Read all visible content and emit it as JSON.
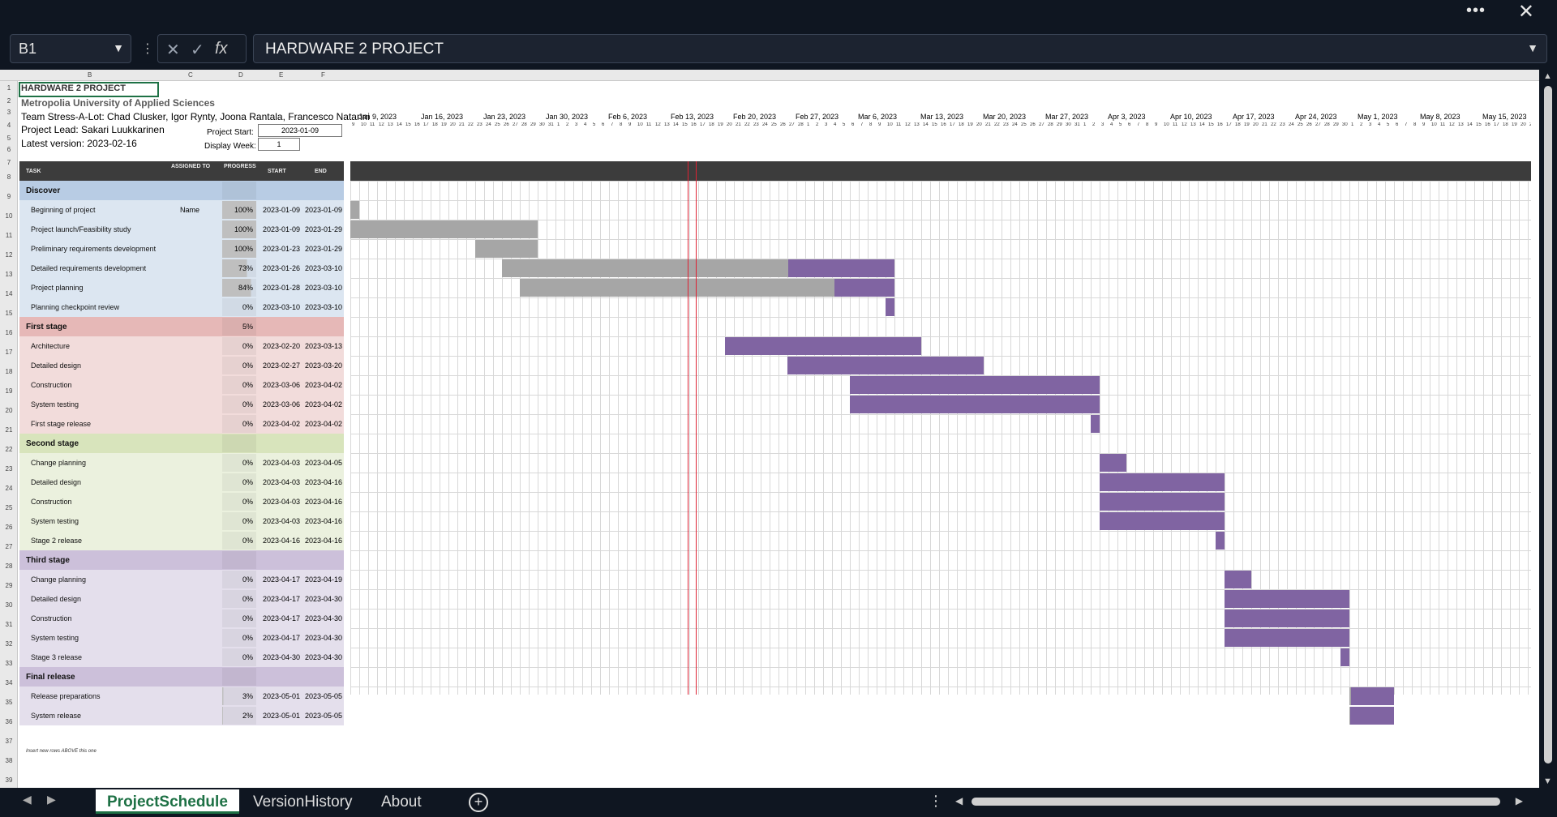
{
  "window": {
    "more_icon": "ellipsis-icon",
    "close_icon": "close-icon"
  },
  "formula_bar": {
    "name_box": "B1",
    "formula": "HARDWARE 2 PROJECT"
  },
  "sheet": {
    "title": "HARDWARE 2 PROJECT",
    "university": "Metropolia University of Applied Sciences",
    "team": "Team Stress-A-Lot: Chad Clusker, Igor Rynty, Joona Rantala, Francesco Natanni",
    "lead": "Project Lead: Sakari Luukkarinen",
    "latest": "Latest version: 2023-02-16",
    "project_start_label": "Project Start:",
    "project_start_value": "2023-01-09",
    "display_week_label": "Display Week:",
    "display_week_value": "1",
    "columns": {
      "task": "TASK",
      "assigned": "ASSIGNED TO",
      "progress": "PROGRESS",
      "start": "START",
      "end": "END"
    },
    "col_letters": [
      "B",
      "C",
      "D",
      "E",
      "F"
    ],
    "insert_note": "Insert new rows ABOVE this one"
  },
  "rows": [
    {
      "name": "Discover",
      "phase": true,
      "color": "#b8cce4",
      "progress": "",
      "start": "",
      "end": ""
    },
    {
      "name": "Beginning of project",
      "assigned": "Name",
      "progress": "100%",
      "start": "2023-01-09",
      "end": "2023-01-09",
      "color": "#dce6f1"
    },
    {
      "name": "Project launch/Feasibility study",
      "progress": "100%",
      "start": "2023-01-09",
      "end": "2023-01-29",
      "color": "#dce6f1"
    },
    {
      "name": "Preliminary requirements development",
      "progress": "100%",
      "start": "2023-01-23",
      "end": "2023-01-29",
      "color": "#dce6f1"
    },
    {
      "name": "Detailed requirements development",
      "progress": "73%",
      "start": "2023-01-26",
      "end": "2023-03-10",
      "color": "#dce6f1"
    },
    {
      "name": "Project planning",
      "progress": "84%",
      "start": "2023-01-28",
      "end": "2023-03-10",
      "color": "#dce6f1"
    },
    {
      "name": "Planning checkpoint review",
      "progress": "0%",
      "start": "2023-03-10",
      "end": "2023-03-10",
      "color": "#dce6f1"
    },
    {
      "name": "First stage",
      "phase": true,
      "color": "#e6b8b7",
      "progress": "5%",
      "start": "",
      "end": ""
    },
    {
      "name": "Architecture",
      "progress": "0%",
      "start": "2023-02-20",
      "end": "2023-03-13",
      "color": "#f2dcdb"
    },
    {
      "name": "Detailed design",
      "progress": "0%",
      "start": "2023-02-27",
      "end": "2023-03-20",
      "color": "#f2dcdb"
    },
    {
      "name": "Construction",
      "progress": "0%",
      "start": "2023-03-06",
      "end": "2023-04-02",
      "color": "#f2dcdb"
    },
    {
      "name": "System testing",
      "progress": "0%",
      "start": "2023-03-06",
      "end": "2023-04-02",
      "color": "#f2dcdb"
    },
    {
      "name": "First stage release",
      "progress": "0%",
      "start": "2023-04-02",
      "end": "2023-04-02",
      "color": "#f2dcdb"
    },
    {
      "name": "Second stage",
      "phase": true,
      "color": "#d8e4bc",
      "progress": "",
      "start": "",
      "end": ""
    },
    {
      "name": "Change planning",
      "progress": "0%",
      "start": "2023-04-03",
      "end": "2023-04-05",
      "color": "#ebf1de"
    },
    {
      "name": "Detailed design",
      "progress": "0%",
      "start": "2023-04-03",
      "end": "2023-04-16",
      "color": "#ebf1de"
    },
    {
      "name": "Construction",
      "progress": "0%",
      "start": "2023-04-03",
      "end": "2023-04-16",
      "color": "#ebf1de"
    },
    {
      "name": "System testing",
      "progress": "0%",
      "start": "2023-04-03",
      "end": "2023-04-16",
      "color": "#ebf1de"
    },
    {
      "name": "Stage 2 release",
      "progress": "0%",
      "start": "2023-04-16",
      "end": "2023-04-16",
      "color": "#ebf1de"
    },
    {
      "name": "Third stage",
      "phase": true,
      "color": "#ccc0da",
      "progress": "",
      "start": "",
      "end": ""
    },
    {
      "name": "Change planning",
      "progress": "0%",
      "start": "2023-04-17",
      "end": "2023-04-19",
      "color": "#e4dfec"
    },
    {
      "name": "Detailed design",
      "progress": "0%",
      "start": "2023-04-17",
      "end": "2023-04-30",
      "color": "#e4dfec"
    },
    {
      "name": "Construction",
      "progress": "0%",
      "start": "2023-04-17",
      "end": "2023-04-30",
      "color": "#e4dfec"
    },
    {
      "name": "System testing",
      "progress": "0%",
      "start": "2023-04-17",
      "end": "2023-04-30",
      "color": "#e4dfec"
    },
    {
      "name": "Stage 3 release",
      "progress": "0%",
      "start": "2023-04-30",
      "end": "2023-04-30",
      "color": "#e4dfec"
    },
    {
      "name": "Final release",
      "phase": true,
      "color": "#ccc0da",
      "progress": "",
      "start": "",
      "end": ""
    },
    {
      "name": "Release preparations",
      "progress": "3%",
      "start": "2023-05-01",
      "end": "2023-05-05",
      "color": "#e4dfec"
    },
    {
      "name": "System release",
      "progress": "2%",
      "start": "2023-05-01",
      "end": "2023-05-05",
      "color": "#e4dfec"
    }
  ],
  "gantt": {
    "week_labels": [
      "Jan 9, 2023",
      "Jan 16, 2023",
      "Jan 23, 2023",
      "Jan 30, 2023",
      "Feb 6, 2023",
      "Feb 13, 2023",
      "Feb 20, 2023",
      "Feb 27, 2023",
      "Mar 6, 2023",
      "Mar 13, 2023",
      "Mar 20, 2023",
      "Mar 27, 2023",
      "Apr 3, 2023",
      "Apr 10, 2023",
      "Apr 17, 2023",
      "Apr 24, 2023",
      "May 1, 2023",
      "May 8, 2023",
      "May 15, 2023"
    ],
    "today": "2023-02-16",
    "completed_color": "#a6a6a6",
    "remaining_color": "#8064a2"
  },
  "tabs": [
    {
      "label": "ProjectSchedule",
      "active": true
    },
    {
      "label": "VersionHistory",
      "active": false
    },
    {
      "label": "About",
      "active": false
    }
  ]
}
